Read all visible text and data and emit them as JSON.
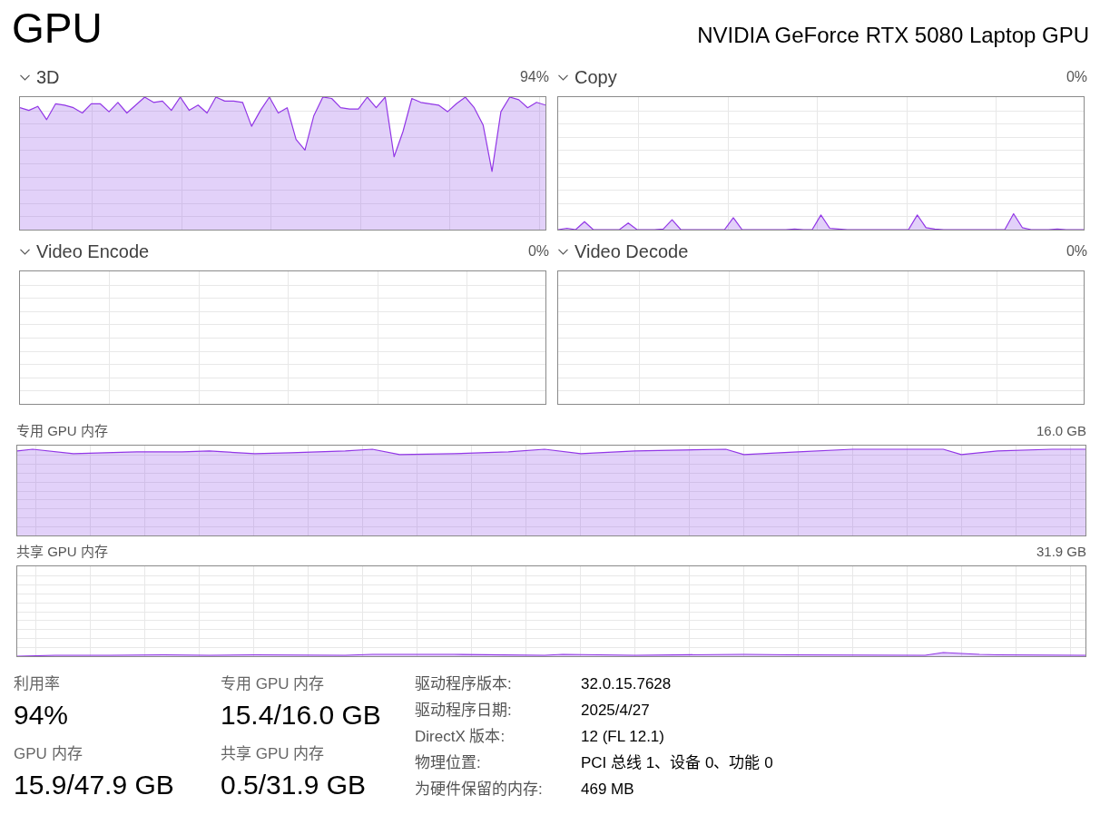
{
  "header": {
    "title": "GPU",
    "adapter_name": "NVIDIA GeForce RTX 5080 Laptop GPU"
  },
  "engines": [
    {
      "name": "3D",
      "reading": "94%"
    },
    {
      "name": "Copy",
      "reading": "0%"
    },
    {
      "name": "Video Encode",
      "reading": "0%"
    },
    {
      "name": "Video Decode",
      "reading": "0%"
    }
  ],
  "memory_graphs": [
    {
      "label": "专用 GPU 内存",
      "capacity": "16.0 GB"
    },
    {
      "label": "共享 GPU 内存",
      "capacity": "31.9 GB"
    }
  ],
  "stats": [
    {
      "label": "利用率",
      "value": "94%"
    },
    {
      "label": "专用 GPU 内存",
      "value": "15.4/16.0 GB"
    },
    {
      "label": "GPU 内存",
      "value": "15.9/47.9 GB"
    },
    {
      "label": "共享 GPU 内存",
      "value": "0.5/31.9 GB"
    }
  ],
  "details": [
    {
      "label": "驱动程序版本:",
      "value": "32.0.15.7628"
    },
    {
      "label": "驱动程序日期:",
      "value": "2025/4/27"
    },
    {
      "label": "DirectX 版本:",
      "value": "12 (FL 12.1)"
    },
    {
      "label": "物理位置:",
      "value": "PCI 总线 1、设备 0、功能 0"
    },
    {
      "label": "为硬件保留的内存:",
      "value": "469 MB"
    }
  ]
}
